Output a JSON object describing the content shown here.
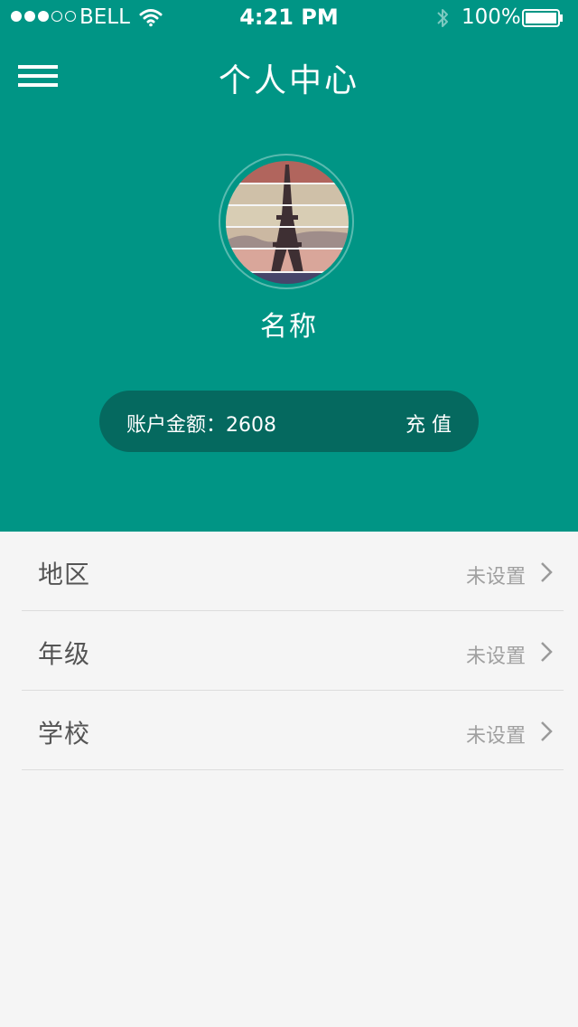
{
  "status_bar": {
    "carrier": "BELL",
    "time": "4:21 PM",
    "battery": "100%"
  },
  "nav": {
    "title": "个人中心",
    "menu_icon": "hamburger-menu-icon"
  },
  "profile": {
    "name": "名称",
    "avatar": "eiffel-tower-avatar"
  },
  "account": {
    "balance_text": "账户金额：2608",
    "recharge_label": "充 值"
  },
  "settings": [
    {
      "label": "地区",
      "value": "未设置"
    },
    {
      "label": "年级",
      "value": "未设置"
    },
    {
      "label": "学校",
      "value": "未设置"
    }
  ],
  "colors": {
    "primary": "#009585",
    "pill": "#05695f",
    "background": "#f5f5f5"
  }
}
